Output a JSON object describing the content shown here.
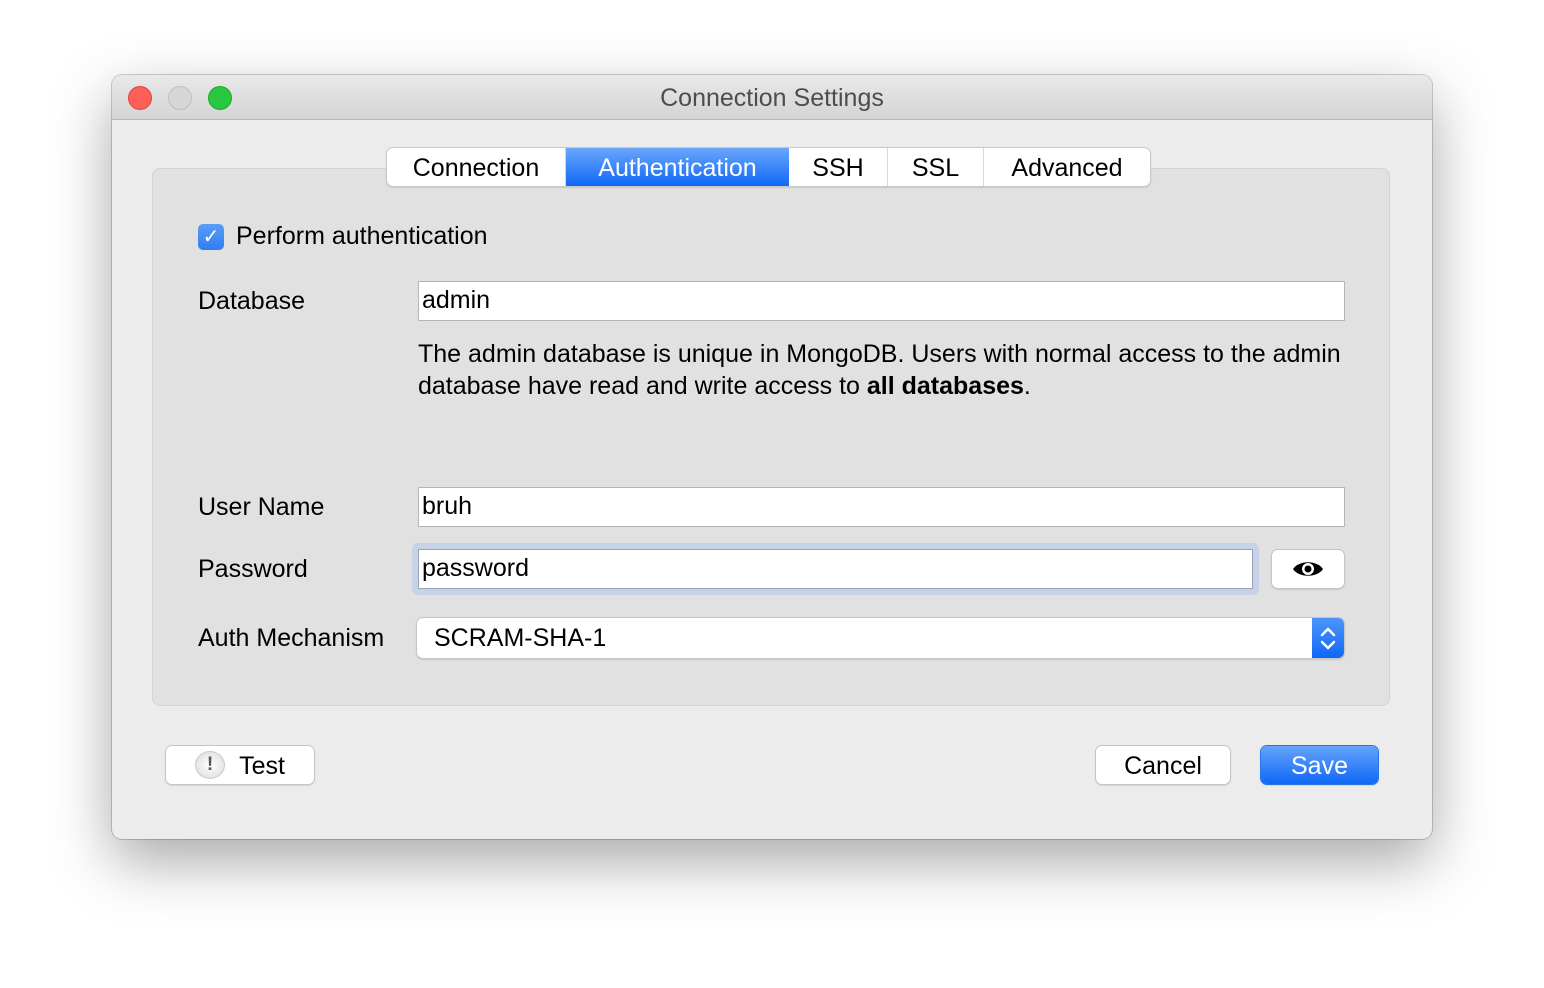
{
  "window": {
    "title": "Connection Settings"
  },
  "tabs": [
    {
      "label": "Connection",
      "active": false
    },
    {
      "label": "Authentication",
      "active": true
    },
    {
      "label": "SSH",
      "active": false
    },
    {
      "label": "SSL",
      "active": false
    },
    {
      "label": "Advanced",
      "active": false
    }
  ],
  "auth": {
    "perform_auth_label": "Perform authentication",
    "perform_auth_checked": true,
    "database_label": "Database",
    "database_value": "admin",
    "help_text_prefix": "The admin database is unique in MongoDB. Users with normal access to the admin database have read and write access to ",
    "help_text_bold": "all databases",
    "help_text_suffix": ".",
    "username_label": "User Name",
    "username_value": "bruh",
    "password_label": "Password",
    "password_value": "password",
    "show_password_icon": "eye-icon",
    "mechanism_label": "Auth Mechanism",
    "mechanism_value": "SCRAM-SHA-1"
  },
  "footer": {
    "test_label": "Test",
    "test_icon": "warning-bubble-icon",
    "cancel_label": "Cancel",
    "save_label": "Save"
  },
  "colors": {
    "accent": "#0f68f8",
    "close": "#fe5f57",
    "maximize": "#28c840"
  }
}
